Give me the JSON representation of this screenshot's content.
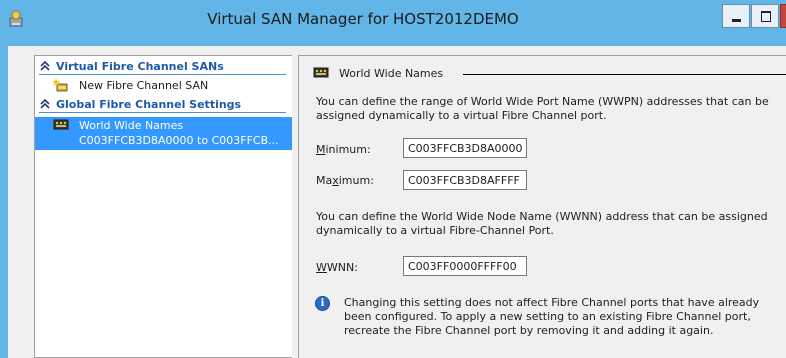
{
  "window": {
    "title": "Virtual SAN Manager for HOST2012DEMO"
  },
  "tree": {
    "groups": [
      {
        "label": "Virtual Fibre Channel SANs"
      },
      {
        "label": "Global Fibre Channel Settings"
      }
    ],
    "new_san": "New Fibre Channel SAN",
    "wwn_item": {
      "label": "World Wide Names",
      "sub": "C003FFCB3D8A0000 to C003FFCB..."
    }
  },
  "panel": {
    "section_title": "World Wide Names",
    "wwpn_desc": "You can define the range of World Wide Port Name (WWPN) addresses that can be assigned dynamically to a virtual Fibre Channel port.",
    "minimum": {
      "label_pre": "",
      "label_key": "M",
      "label_post": "inimum:",
      "value": "C003FFCB3D8A0000"
    },
    "maximum": {
      "label_pre": "Ma",
      "label_key": "x",
      "label_post": "imum:",
      "value": "C003FFCB3D8AFFFF"
    },
    "wwnn_desc": "You can define the World Wide Node Name (WWNN) address that can be assigned dynamically to a virtual Fibre-Channel Port.",
    "wwnn": {
      "label_pre": "",
      "label_key": "W",
      "label_post": "WNN:",
      "value": "C003FF0000FFFF00"
    },
    "info_text": "Changing this setting does not affect Fibre Channel ports that have already been configured. To apply a new setting to an existing Fibre Channel port, recreate the Fibre Channel port by removing it and adding it again."
  },
  "colors": {
    "titlebar": "#62b5e7",
    "selection": "#3399ff",
    "group_header": "#1f5aa8",
    "close_button": "#c7463b"
  },
  "icons": {
    "app": "san-manager-icon",
    "new_san": "new-san-icon",
    "wwn": "world-wide-names-icon",
    "chevron": "double-chevron-up-icon",
    "info": "info-icon"
  }
}
